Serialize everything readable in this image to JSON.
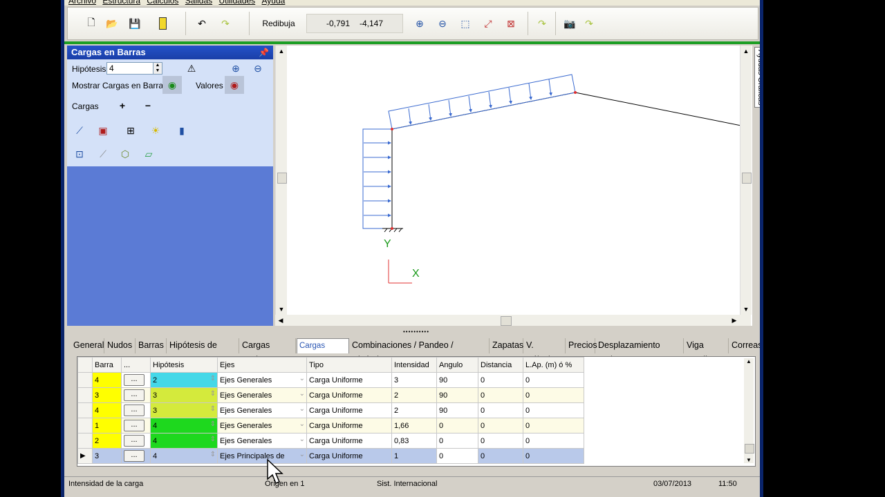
{
  "menu": [
    "Archivo",
    "Estructura",
    "Cálculos",
    "Salidas",
    "Utilidades",
    "Ayuda"
  ],
  "toolbar": {
    "redibuja": "Redibuja",
    "coord_x": "-0,791",
    "coord_y": "-4,147"
  },
  "panel": {
    "title": "Cargas en Barras",
    "hipotesis_label": "Hipótesis",
    "hipotesis_value": "4",
    "mostrar_label": "Mostrar Cargas en Barras",
    "valores_label": "Valores",
    "cargas_label": "Cargas",
    "plus": "+",
    "minus": "−"
  },
  "canvas": {
    "axis_y": "Y",
    "axis_x": "X"
  },
  "side_tab": "Ayudas Gráficas",
  "tabs": [
    "General",
    "Nudos",
    "Barras",
    "Hipótesis de carga",
    "Cargas Nudos",
    "Cargas Barras",
    "Combinaciones / Pandeo / Dinámico",
    "Zapatas",
    "V. Cálculo",
    "Precios",
    "Desplazamiento nudos",
    "Viga Carril",
    "Correas"
  ],
  "grid": {
    "headers": [
      "Barra",
      "...",
      "Hipótesis",
      "Ejes",
      "Tipo",
      "Intensidad",
      "Angulo",
      "Distancia",
      "L.Ap. (m) ó %"
    ],
    "rows": [
      {
        "barra": "4",
        "btn": "...",
        "hip": "2",
        "ejes": "Ejes Generales",
        "tipo": "Carga Uniforme",
        "intensidad": "3",
        "angulo": "90",
        "distancia": "0",
        "lap": "0",
        "hipcolor": "#45d8e8"
      },
      {
        "barra": "3",
        "btn": "...",
        "hip": "3",
        "ejes": "Ejes Generales",
        "tipo": "Carga Uniforme",
        "intensidad": "2",
        "angulo": "90",
        "distancia": "0",
        "lap": "0",
        "hipcolor": "#d4ea3c"
      },
      {
        "barra": "4",
        "btn": "...",
        "hip": "3",
        "ejes": "Ejes Generales",
        "tipo": "Carga Uniforme",
        "intensidad": "2",
        "angulo": "90",
        "distancia": "0",
        "lap": "0",
        "hipcolor": "#d4ea3c"
      },
      {
        "barra": "1",
        "btn": "...",
        "hip": "4",
        "ejes": "Ejes Generales",
        "tipo": "Carga Uniforme",
        "intensidad": "1,66",
        "angulo": "0",
        "distancia": "0",
        "lap": "0",
        "hipcolor": "#1ed81e"
      },
      {
        "barra": "2",
        "btn": "...",
        "hip": "4",
        "ejes": "Ejes Generales",
        "tipo": "Carga Uniforme",
        "intensidad": "0,83",
        "angulo": "0",
        "distancia": "0",
        "lap": "0",
        "hipcolor": "#1ed81e"
      },
      {
        "barra": "3",
        "btn": "...",
        "hip": "4",
        "ejes": "Ejes Principales de",
        "tipo": "Carga Uniforme",
        "intensidad": "1",
        "angulo": "0",
        "distancia": "0",
        "lap": "0",
        "hipcolor": "#b9c9ea"
      }
    ]
  },
  "status": {
    "left": "Intensidad de la carga",
    "origin": "Origen en 1",
    "units": "Sist. Internacional",
    "date": "03/07/2013",
    "time": "11:50"
  },
  "colors": {
    "barra_yellow": "#ffff00",
    "selected_row": "#b9c9ea",
    "panel_blue": "#5b7bd5",
    "green_bar": "#1c9e24"
  }
}
